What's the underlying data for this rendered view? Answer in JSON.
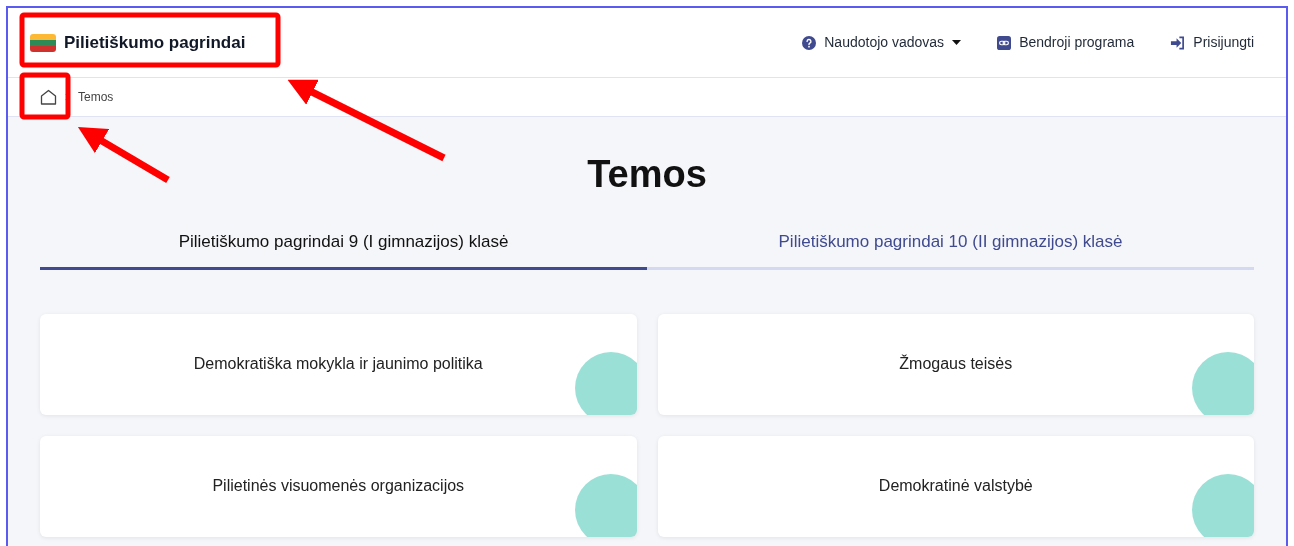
{
  "header": {
    "brand": "Pilietiškumo pagrindai",
    "nav": [
      {
        "kind": "help",
        "label": "Naudotojo vadovas",
        "dropdown": true
      },
      {
        "kind": "link",
        "label": "Bendroji programa",
        "dropdown": false
      },
      {
        "kind": "login",
        "label": "Prisijungti",
        "dropdown": false
      }
    ]
  },
  "breadcrumb": {
    "items": [
      "Temos"
    ]
  },
  "page_title": "Temos",
  "tabs": [
    {
      "label": "Pilietiškumo pagrindai 9 (I gimnazijos) klasė",
      "selected": true
    },
    {
      "label": "Pilietiškumo pagrindai 10 (II gimnazijos) klasė",
      "selected": false
    }
  ],
  "topics": [
    "Demokratiška mokykla ir jaunimo politika",
    "Žmogaus teisės",
    "Pilietinės visuomenės organizacijos",
    "Demokratinė valstybė"
  ]
}
